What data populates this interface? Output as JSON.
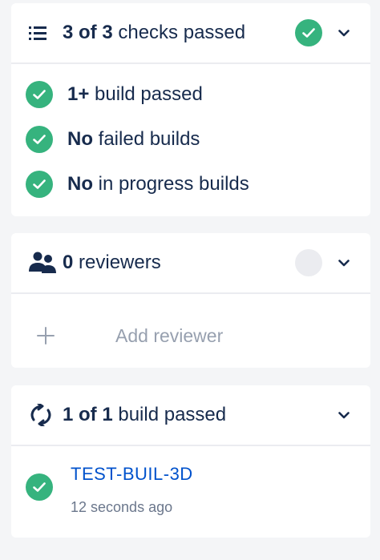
{
  "checks": {
    "count_bold": "3 of 3",
    "count_text": " checks passed",
    "status_icon": "check-icon",
    "items": [
      {
        "bold": "1+",
        "text": " build passed"
      },
      {
        "bold": "No",
        "text": " failed builds"
      },
      {
        "bold": "No",
        "text": " in progress builds"
      }
    ]
  },
  "reviewers": {
    "count_bold": "0",
    "count_text": " reviewers",
    "add_label": "Add reviewer"
  },
  "builds": {
    "count_bold": "1 of 1",
    "count_text": " build passed",
    "items": [
      {
        "name": "TEST-BUIL-3D",
        "time": "12 seconds ago"
      }
    ]
  },
  "colors": {
    "success": "#36b37e",
    "link": "#0052cc",
    "text": "#172b4d",
    "muted": "#97a0af"
  }
}
